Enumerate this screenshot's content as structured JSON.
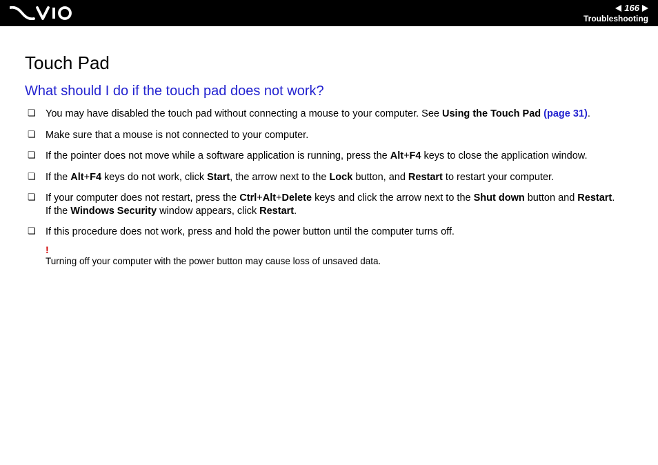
{
  "header": {
    "page_number": "166",
    "section": "Troubleshooting"
  },
  "page": {
    "title": "Touch Pad",
    "question": "What should I do if the touch pad does not work?"
  },
  "bullets": {
    "b1_a": "You may have disabled the touch pad without connecting a mouse to your computer. See ",
    "b1_b": "Using the Touch Pad",
    "b1_c": " (page 31)",
    "b1_d": ".",
    "b2": "Make sure that a mouse is not connected to your computer.",
    "b3_a": "If the pointer does not move while a software application is running, press the ",
    "b3_b": "Alt",
    "b3_c": "+",
    "b3_d": "F4",
    "b3_e": " keys to close the application window.",
    "b4_a": "If the ",
    "b4_b": "Alt",
    "b4_c": "+",
    "b4_d": "F4",
    "b4_e": " keys do not work, click ",
    "b4_f": "Start",
    "b4_g": ", the arrow next to the ",
    "b4_h": "Lock",
    "b4_i": " button, and ",
    "b4_j": "Restart",
    "b4_k": " to restart your computer.",
    "b5_a": "If your computer does not restart, press the ",
    "b5_b": "Ctrl",
    "b5_c": "+",
    "b5_d": "Alt",
    "b5_e": "+",
    "b5_f": "Delete",
    "b5_g": " keys and click the arrow next to the ",
    "b5_h": "Shut down",
    "b5_i": " button and ",
    "b5_j": "Restart",
    "b5_k": ".",
    "b5_l": "If the ",
    "b5_m": "Windows Security",
    "b5_n": " window appears, click ",
    "b5_o": "Restart",
    "b5_p": ".",
    "b6": "If this procedure does not work, press and hold the power button until the computer turns off."
  },
  "warning": {
    "mark": "!",
    "text": "Turning off your computer with the power button may cause loss of unsaved data."
  }
}
